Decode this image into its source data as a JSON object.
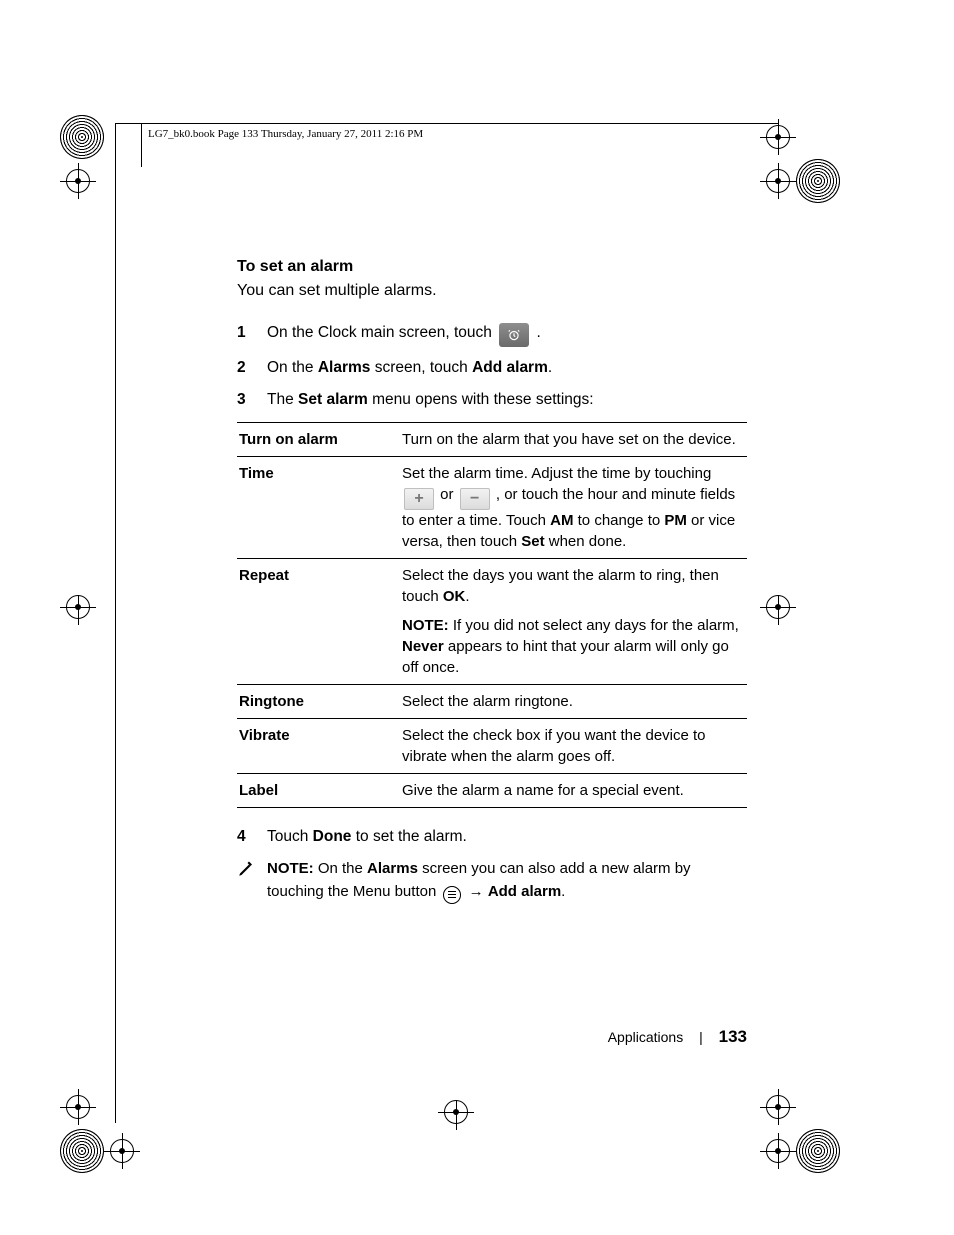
{
  "header": {
    "running_head": "LG7_bk0.book  Page 133  Thursday, January 27, 2011  2:16 PM"
  },
  "section": {
    "heading": "To set an alarm",
    "intro": "You can set multiple alarms."
  },
  "steps": {
    "s1": {
      "num": "1",
      "pre": "On the Clock main screen, touch ",
      "post": "."
    },
    "s2": {
      "num": "2",
      "pre": "On the ",
      "b1": "Alarms",
      "mid": " screen, touch ",
      "b2": "Add alarm",
      "post": "."
    },
    "s3": {
      "num": "3",
      "pre": "The ",
      "b1": "Set alarm",
      "post": " menu opens with these settings:"
    },
    "s4": {
      "num": "4",
      "pre": "Touch ",
      "b1": "Done",
      "post": " to set the alarm."
    }
  },
  "settings": {
    "rows": {
      "r0": {
        "label": "Turn on alarm",
        "desc": "Turn on the alarm that you have set on the device."
      },
      "r1": {
        "label": "Time",
        "line1": "Set the alarm time. Adjust the time by touching",
        "line2_or": " or ",
        "line2_tail": ", or touch the hour and minute fields to enter a time. Touch ",
        "line2_am": "AM",
        "line2_mid": " to change to ",
        "line2_pm": "PM",
        "line2_tail2": " or vice versa, then touch ",
        "line2_set": "Set",
        "line2_end": " when done."
      },
      "r2": {
        "label": "Repeat",
        "line1_a": "Select the days you want the alarm to ring, then touch ",
        "line1_ok": "OK",
        "line1_b": ".",
        "note_label": "NOTE:",
        "note_body_a": " If you did not select any days for the alarm, ",
        "note_never": "Never",
        "note_body_b": " appears to hint that your alarm will only go off once."
      },
      "r3": {
        "label": "Ringtone",
        "desc": "Select the alarm ringtone."
      },
      "r4": {
        "label": "Vibrate",
        "desc": "Select the check box if you want the device to vibrate when the alarm goes off."
      },
      "r5": {
        "label": "Label",
        "desc": "Give the alarm a name for a special event."
      }
    }
  },
  "note": {
    "label": "NOTE:",
    "body_a": " On the ",
    "b1": "Alarms",
    "body_b": " screen you can also add a new alarm by touching the Menu button ",
    "arrow": "→ ",
    "b2": "Add alarm",
    "body_c": "."
  },
  "footer": {
    "section": "Applications",
    "page": "133"
  },
  "icons": {
    "alarm": "alarm-clock-icon",
    "plus": "plus-icon",
    "minus": "minus-icon",
    "note": "pencil-note-icon",
    "menu": "menu-button-icon"
  }
}
